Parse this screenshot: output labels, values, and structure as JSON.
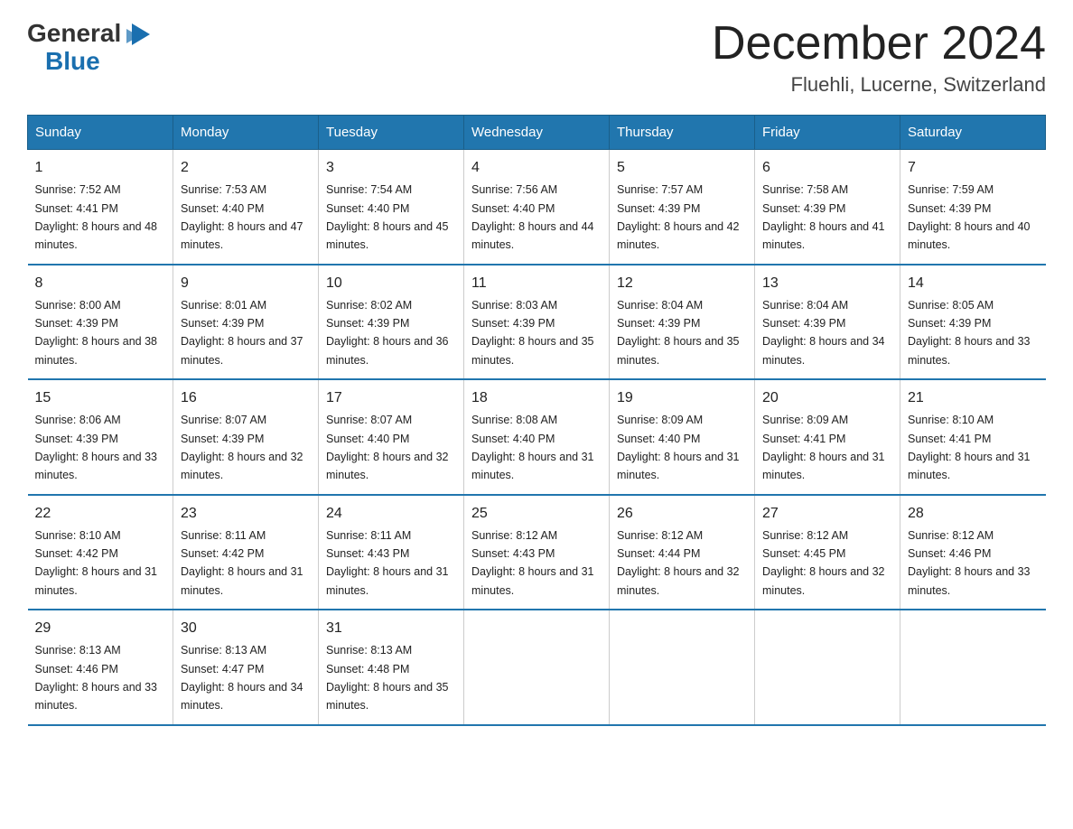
{
  "header": {
    "logo_general": "General",
    "logo_blue": "Blue",
    "month": "December 2024",
    "location": "Fluehli, Lucerne, Switzerland"
  },
  "days_of_week": [
    "Sunday",
    "Monday",
    "Tuesday",
    "Wednesday",
    "Thursday",
    "Friday",
    "Saturday"
  ],
  "weeks": [
    [
      {
        "day": "1",
        "sunrise": "7:52 AM",
        "sunset": "4:41 PM",
        "daylight": "8 hours and 48 minutes."
      },
      {
        "day": "2",
        "sunrise": "7:53 AM",
        "sunset": "4:40 PM",
        "daylight": "8 hours and 47 minutes."
      },
      {
        "day": "3",
        "sunrise": "7:54 AM",
        "sunset": "4:40 PM",
        "daylight": "8 hours and 45 minutes."
      },
      {
        "day": "4",
        "sunrise": "7:56 AM",
        "sunset": "4:40 PM",
        "daylight": "8 hours and 44 minutes."
      },
      {
        "day": "5",
        "sunrise": "7:57 AM",
        "sunset": "4:39 PM",
        "daylight": "8 hours and 42 minutes."
      },
      {
        "day": "6",
        "sunrise": "7:58 AM",
        "sunset": "4:39 PM",
        "daylight": "8 hours and 41 minutes."
      },
      {
        "day": "7",
        "sunrise": "7:59 AM",
        "sunset": "4:39 PM",
        "daylight": "8 hours and 40 minutes."
      }
    ],
    [
      {
        "day": "8",
        "sunrise": "8:00 AM",
        "sunset": "4:39 PM",
        "daylight": "8 hours and 38 minutes."
      },
      {
        "day": "9",
        "sunrise": "8:01 AM",
        "sunset": "4:39 PM",
        "daylight": "8 hours and 37 minutes."
      },
      {
        "day": "10",
        "sunrise": "8:02 AM",
        "sunset": "4:39 PM",
        "daylight": "8 hours and 36 minutes."
      },
      {
        "day": "11",
        "sunrise": "8:03 AM",
        "sunset": "4:39 PM",
        "daylight": "8 hours and 35 minutes."
      },
      {
        "day": "12",
        "sunrise": "8:04 AM",
        "sunset": "4:39 PM",
        "daylight": "8 hours and 35 minutes."
      },
      {
        "day": "13",
        "sunrise": "8:04 AM",
        "sunset": "4:39 PM",
        "daylight": "8 hours and 34 minutes."
      },
      {
        "day": "14",
        "sunrise": "8:05 AM",
        "sunset": "4:39 PM",
        "daylight": "8 hours and 33 minutes."
      }
    ],
    [
      {
        "day": "15",
        "sunrise": "8:06 AM",
        "sunset": "4:39 PM",
        "daylight": "8 hours and 33 minutes."
      },
      {
        "day": "16",
        "sunrise": "8:07 AM",
        "sunset": "4:39 PM",
        "daylight": "8 hours and 32 minutes."
      },
      {
        "day": "17",
        "sunrise": "8:07 AM",
        "sunset": "4:40 PM",
        "daylight": "8 hours and 32 minutes."
      },
      {
        "day": "18",
        "sunrise": "8:08 AM",
        "sunset": "4:40 PM",
        "daylight": "8 hours and 31 minutes."
      },
      {
        "day": "19",
        "sunrise": "8:09 AM",
        "sunset": "4:40 PM",
        "daylight": "8 hours and 31 minutes."
      },
      {
        "day": "20",
        "sunrise": "8:09 AM",
        "sunset": "4:41 PM",
        "daylight": "8 hours and 31 minutes."
      },
      {
        "day": "21",
        "sunrise": "8:10 AM",
        "sunset": "4:41 PM",
        "daylight": "8 hours and 31 minutes."
      }
    ],
    [
      {
        "day": "22",
        "sunrise": "8:10 AM",
        "sunset": "4:42 PM",
        "daylight": "8 hours and 31 minutes."
      },
      {
        "day": "23",
        "sunrise": "8:11 AM",
        "sunset": "4:42 PM",
        "daylight": "8 hours and 31 minutes."
      },
      {
        "day": "24",
        "sunrise": "8:11 AM",
        "sunset": "4:43 PM",
        "daylight": "8 hours and 31 minutes."
      },
      {
        "day": "25",
        "sunrise": "8:12 AM",
        "sunset": "4:43 PM",
        "daylight": "8 hours and 31 minutes."
      },
      {
        "day": "26",
        "sunrise": "8:12 AM",
        "sunset": "4:44 PM",
        "daylight": "8 hours and 32 minutes."
      },
      {
        "day": "27",
        "sunrise": "8:12 AM",
        "sunset": "4:45 PM",
        "daylight": "8 hours and 32 minutes."
      },
      {
        "day": "28",
        "sunrise": "8:12 AM",
        "sunset": "4:46 PM",
        "daylight": "8 hours and 33 minutes."
      }
    ],
    [
      {
        "day": "29",
        "sunrise": "8:13 AM",
        "sunset": "4:46 PM",
        "daylight": "8 hours and 33 minutes."
      },
      {
        "day": "30",
        "sunrise": "8:13 AM",
        "sunset": "4:47 PM",
        "daylight": "8 hours and 34 minutes."
      },
      {
        "day": "31",
        "sunrise": "8:13 AM",
        "sunset": "4:48 PM",
        "daylight": "8 hours and 35 minutes."
      },
      null,
      null,
      null,
      null
    ]
  ]
}
